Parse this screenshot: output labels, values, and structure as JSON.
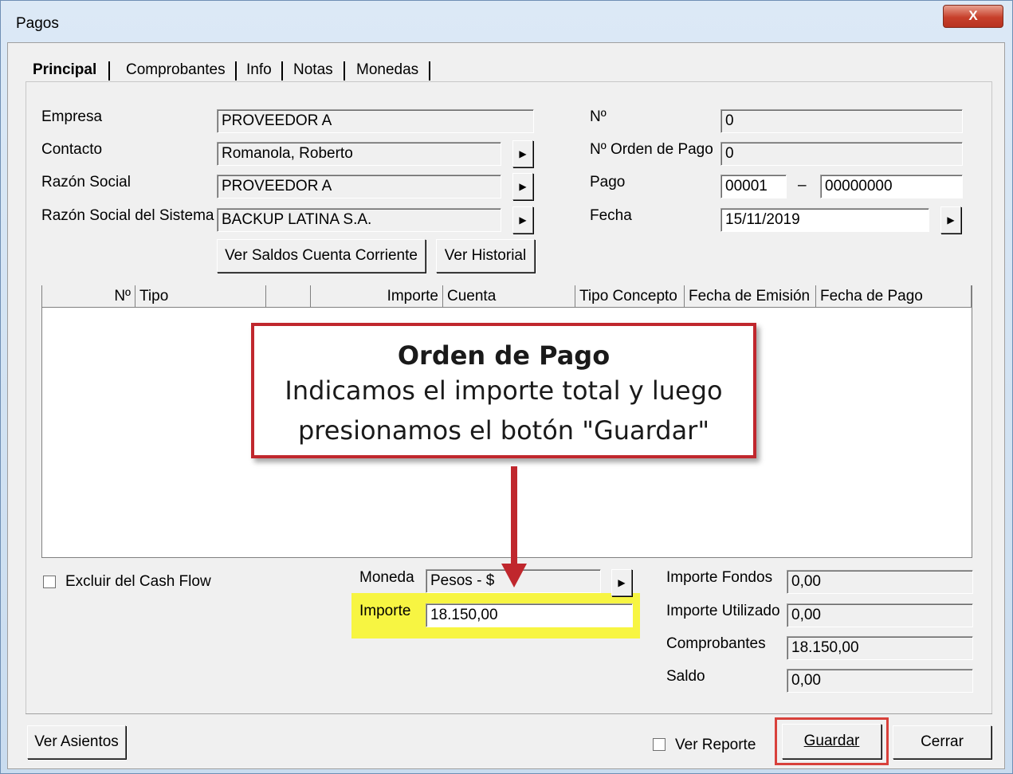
{
  "window": {
    "title": "Pagos",
    "close_glyph": "X"
  },
  "tabs": [
    "Principal",
    "Comprobantes",
    "Info",
    "Notas",
    "Monedas"
  ],
  "left_fields": {
    "empresa": {
      "label": "Empresa",
      "value": "PROVEEDOR A"
    },
    "contacto": {
      "label": "Contacto",
      "value": "Romanola, Roberto"
    },
    "razon_social": {
      "label": "Razón Social",
      "value": "PROVEEDOR A"
    },
    "razon_social_sistema": {
      "label": "Razón Social del Sistema",
      "value": "BACKUP LATINA S.A."
    }
  },
  "right_fields": {
    "numero": {
      "label": "Nº",
      "value": "0"
    },
    "orden_pago": {
      "label": "Nº Orden de Pago",
      "value": "0"
    },
    "pago": {
      "label": "Pago",
      "value_a": "00001",
      "separator": "–",
      "value_b": "00000000"
    },
    "fecha": {
      "label": "Fecha",
      "value": "15/11/2019"
    }
  },
  "buttons": {
    "ver_saldos": "Ver Saldos Cuenta Corriente",
    "ver_historial": "Ver Historial",
    "ver_asientos": "Ver Asientos",
    "guardar": "Guardar",
    "cerrar": "Cerrar",
    "arrow_glyph": "▶"
  },
  "grid": {
    "columns": [
      "Nº",
      "Tipo",
      "",
      "Importe",
      "Cuenta",
      "Tipo Concepto",
      "Fecha de Emisión",
      "Fecha de Pago"
    ]
  },
  "callout": {
    "heading": "Orden de Pago",
    "line1": "Indicamos el importe total y luego",
    "line2": "presionamos el botón \"Guardar\"",
    "border_color": "#c0272d"
  },
  "bottom_left": {
    "excluir_label": "Excluir del Cash Flow",
    "moneda_label": "Moneda",
    "moneda_value": "Pesos - $",
    "importe_label": "Importe",
    "importe_value": "18.150,00",
    "highlight_color": "#f7f542"
  },
  "totals": {
    "importe_fondos": {
      "label": "Importe Fondos",
      "value": "0,00"
    },
    "importe_utilizado": {
      "label": "Importe Utilizado",
      "value": "0,00"
    },
    "comprobantes": {
      "label": "Comprobantes",
      "value": "18.150,00"
    },
    "saldo": {
      "label": "Saldo",
      "value": "0,00"
    }
  },
  "footer": {
    "ver_reporte_label": "Ver Reporte"
  }
}
